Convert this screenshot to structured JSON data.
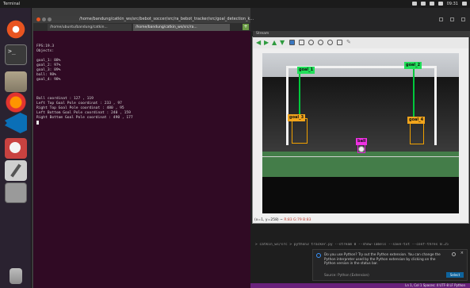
{
  "top_panel": {
    "title": "Terminal",
    "clock": "09:31"
  },
  "terminal": {
    "title": "/home/bandung/catkin_ws/src/bebot_soccer/src/ra_bebot_tracker/src/goal_detection_k...",
    "tabs": [
      "/home/ubuntu/bandung/catkin...",
      "/home/bandung/catkin_ws/src/ra..."
    ],
    "lines": [
      "FPS:19.3",
      "Objects:",
      "",
      "goal_1: 88%",
      "goal_2: 97%",
      "goal_3: 89%",
      "ball: 98%",
      "goal_4: 98%",
      "",
      "",
      "",
      "Ball coordinat : 127 , 119",
      "Left Top Goal Pole coordinat : 233 , 97",
      "Right Top Goal Pole coordinat : 480 , 95",
      "Left Bottom Goal Pole coordinat : 240 , 159",
      "Right Bottom Goal Pole coordinat : 490 , 177"
    ]
  },
  "viewer": {
    "title": "Stream",
    "status_prefix": "(x=1, y=258) ~",
    "status_rgb": "R:83 G:79 B:83",
    "detections": {
      "goal1": "goal_1",
      "goal2": "goal_2",
      "goal3": "goal_3",
      "goal4": "goal_4",
      "ball": "ball"
    }
  },
  "vscode": {
    "terminal_line": "> catkin_ws/src > python3 tracker.py --stream 0 --show-labels --save-txt --conf-thres 0.25",
    "notification": {
      "message": "Do you use Python? Try out the Python extension. You can change the Python interpreter used by the Python extension by clicking on the Python version in the status bar.",
      "source": "Source: Python (Extension)",
      "button": "Select"
    },
    "status": "Ln 1, Col 1  Spaces: 4  UTF-8  LF  Python"
  },
  "colors": {
    "terminal_bg": "#300a24",
    "goal_top": "#22e05a",
    "goal_bottom": "#f2a51c",
    "ball": "#ef31e3"
  }
}
